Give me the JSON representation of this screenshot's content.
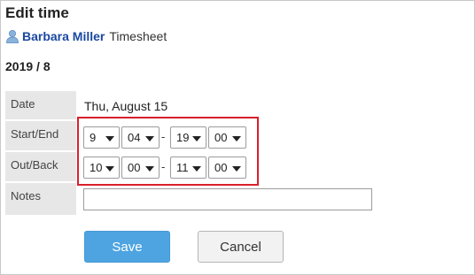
{
  "page": {
    "title": "Edit time"
  },
  "user": {
    "name": "Barbara Miller",
    "suffix": "Timesheet",
    "icon": "user-icon"
  },
  "period": "2019 / 8",
  "form": {
    "date_label": "Date",
    "date_value": "Thu, August 15",
    "start_end_label": "Start/End",
    "start": {
      "hour": "9",
      "minute": "04"
    },
    "end": {
      "hour": "19",
      "minute": "00"
    },
    "out_back_label": "Out/Back",
    "out": {
      "hour": "10",
      "minute": "00"
    },
    "back": {
      "hour": "11",
      "minute": "00"
    },
    "separator": "-",
    "notes_label": "Notes",
    "notes_value": ""
  },
  "buttons": {
    "save": "Save",
    "cancel": "Cancel"
  },
  "colors": {
    "accent": "#4ea4e1",
    "link": "#1a47a0",
    "highlight": "#d9202a",
    "label_bg": "#e7e7e7"
  }
}
